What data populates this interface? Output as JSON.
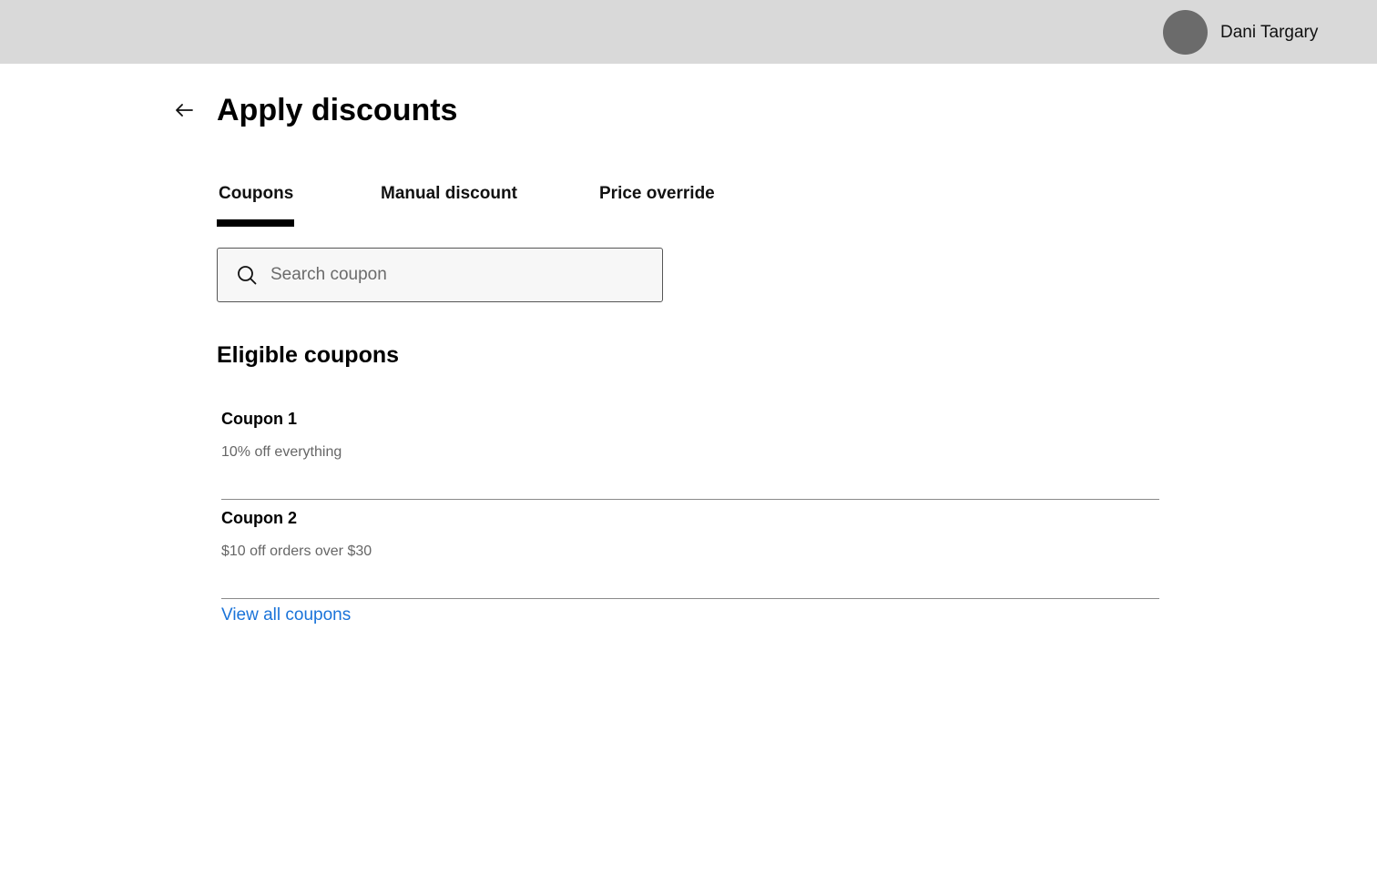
{
  "header": {
    "user_name": "Dani Targary",
    "avatar_color": "#6b6b6b",
    "background_color": "#d9d9d9"
  },
  "page": {
    "title": "Apply discounts",
    "back_icon": "arrow-left-icon"
  },
  "tabs": [
    {
      "label": "Coupons",
      "active": true
    },
    {
      "label": "Manual discount",
      "active": false
    },
    {
      "label": "Price override",
      "active": false
    }
  ],
  "search": {
    "placeholder": "Search coupon",
    "value": "",
    "icon": "search-icon"
  },
  "eligible": {
    "title": "Eligible coupons",
    "coupons": [
      {
        "name": "Coupon 1",
        "description": "10% off everything"
      },
      {
        "name": "Coupon 2",
        "description": "$10 off orders over $30"
      }
    ],
    "view_all_label": "View all coupons",
    "link_color": "#1a73d9"
  }
}
